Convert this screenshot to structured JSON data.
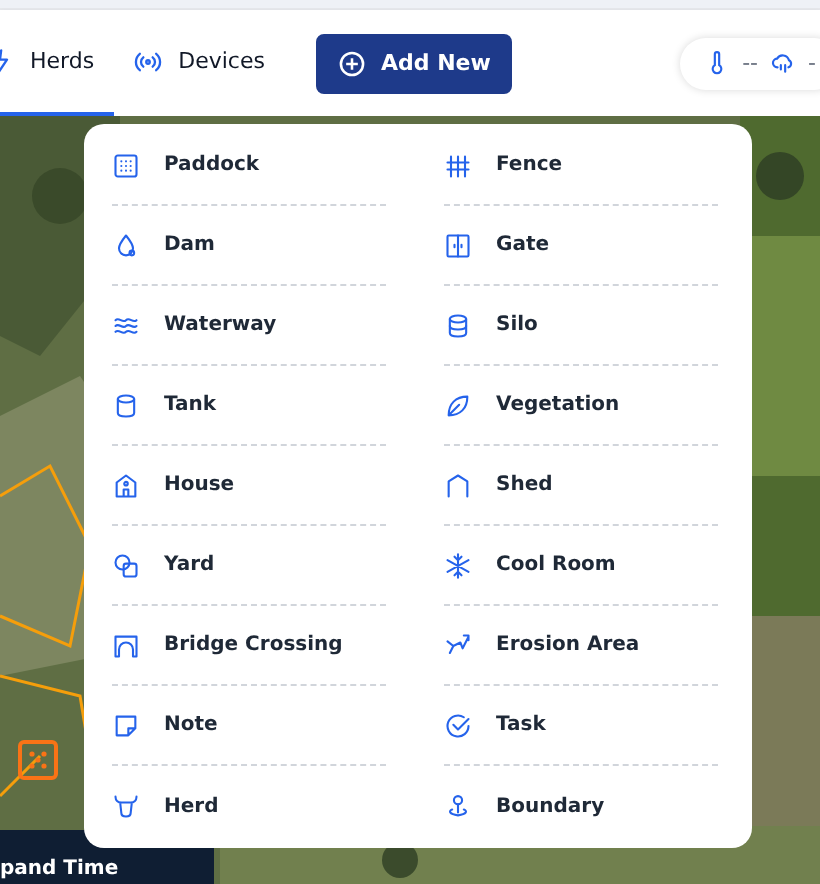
{
  "tabs": [
    {
      "label": "Herds",
      "kind": "herd",
      "selected": true
    },
    {
      "label": "Devices",
      "kind": "signal",
      "selected": false
    }
  ],
  "add_button": "Add New",
  "weather": {
    "temperature": "--",
    "rain": "-"
  },
  "menu": {
    "items": [
      {
        "label": "Paddock",
        "kind": "paddock"
      },
      {
        "label": "Fence",
        "kind": "fence"
      },
      {
        "label": "Dam",
        "kind": "dam"
      },
      {
        "label": "Gate",
        "kind": "gate"
      },
      {
        "label": "Waterway",
        "kind": "waves"
      },
      {
        "label": "Silo",
        "kind": "silo"
      },
      {
        "label": "Tank",
        "kind": "tank"
      },
      {
        "label": "Vegetation",
        "kind": "leaf"
      },
      {
        "label": "House",
        "kind": "house"
      },
      {
        "label": "Shed",
        "kind": "shed"
      },
      {
        "label": "Yard",
        "kind": "yard"
      },
      {
        "label": "Cool Room",
        "kind": "snow"
      },
      {
        "label": "Bridge Crossing",
        "kind": "bridge"
      },
      {
        "label": "Erosion Area",
        "kind": "erosion"
      },
      {
        "label": "Note",
        "kind": "note"
      },
      {
        "label": "Task",
        "kind": "task"
      },
      {
        "label": "Herd",
        "kind": "cow"
      },
      {
        "label": "Boundary",
        "kind": "pin"
      }
    ]
  },
  "timeline_button": "pand Time"
}
